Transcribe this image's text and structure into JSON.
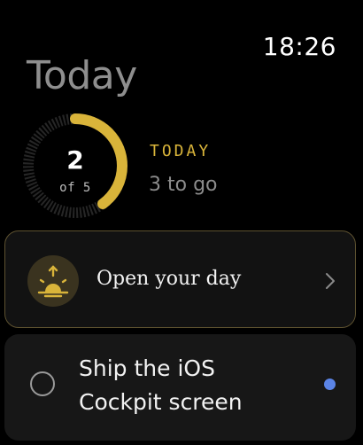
{
  "status_bar": {
    "time": "18:26"
  },
  "page": {
    "title": "Today"
  },
  "progress": {
    "done": 2,
    "total": 5,
    "done_label": "2",
    "of_label": "of 5",
    "fraction": 0.4,
    "accent_color": "#d9b43a",
    "track_color": "#2a2a2a"
  },
  "summary": {
    "label": "TODAY",
    "subtitle": "3 to go"
  },
  "open_day": {
    "label": "Open your day",
    "icon": "sunrise-icon",
    "chevron_icon": "chevron-right-icon"
  },
  "tasks": [
    {
      "title": "Ship the iOS Cockpit screen",
      "done": false,
      "indicator_color": "#5b84e6"
    }
  ]
}
